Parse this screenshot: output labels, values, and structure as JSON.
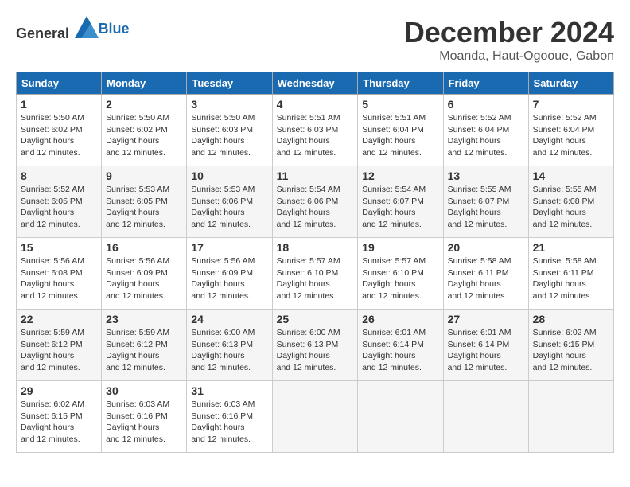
{
  "header": {
    "logo_general": "General",
    "logo_blue": "Blue",
    "month_title": "December 2024",
    "location": "Moanda, Haut-Ogooue, Gabon"
  },
  "days_of_week": [
    "Sunday",
    "Monday",
    "Tuesday",
    "Wednesday",
    "Thursday",
    "Friday",
    "Saturday"
  ],
  "weeks": [
    [
      {
        "day": "1",
        "sunrise": "5:50 AM",
        "sunset": "6:02 PM",
        "daylight": "12 hours and 12 minutes."
      },
      {
        "day": "2",
        "sunrise": "5:50 AM",
        "sunset": "6:02 PM",
        "daylight": "12 hours and 12 minutes."
      },
      {
        "day": "3",
        "sunrise": "5:50 AM",
        "sunset": "6:03 PM",
        "daylight": "12 hours and 12 minutes."
      },
      {
        "day": "4",
        "sunrise": "5:51 AM",
        "sunset": "6:03 PM",
        "daylight": "12 hours and 12 minutes."
      },
      {
        "day": "5",
        "sunrise": "5:51 AM",
        "sunset": "6:04 PM",
        "daylight": "12 hours and 12 minutes."
      },
      {
        "day": "6",
        "sunrise": "5:52 AM",
        "sunset": "6:04 PM",
        "daylight": "12 hours and 12 minutes."
      },
      {
        "day": "7",
        "sunrise": "5:52 AM",
        "sunset": "6:04 PM",
        "daylight": "12 hours and 12 minutes."
      }
    ],
    [
      {
        "day": "8",
        "sunrise": "5:52 AM",
        "sunset": "6:05 PM",
        "daylight": "12 hours and 12 minutes."
      },
      {
        "day": "9",
        "sunrise": "5:53 AM",
        "sunset": "6:05 PM",
        "daylight": "12 hours and 12 minutes."
      },
      {
        "day": "10",
        "sunrise": "5:53 AM",
        "sunset": "6:06 PM",
        "daylight": "12 hours and 12 minutes."
      },
      {
        "day": "11",
        "sunrise": "5:54 AM",
        "sunset": "6:06 PM",
        "daylight": "12 hours and 12 minutes."
      },
      {
        "day": "12",
        "sunrise": "5:54 AM",
        "sunset": "6:07 PM",
        "daylight": "12 hours and 12 minutes."
      },
      {
        "day": "13",
        "sunrise": "5:55 AM",
        "sunset": "6:07 PM",
        "daylight": "12 hours and 12 minutes."
      },
      {
        "day": "14",
        "sunrise": "5:55 AM",
        "sunset": "6:08 PM",
        "daylight": "12 hours and 12 minutes."
      }
    ],
    [
      {
        "day": "15",
        "sunrise": "5:56 AM",
        "sunset": "6:08 PM",
        "daylight": "12 hours and 12 minutes."
      },
      {
        "day": "16",
        "sunrise": "5:56 AM",
        "sunset": "6:09 PM",
        "daylight": "12 hours and 12 minutes."
      },
      {
        "day": "17",
        "sunrise": "5:56 AM",
        "sunset": "6:09 PM",
        "daylight": "12 hours and 12 minutes."
      },
      {
        "day": "18",
        "sunrise": "5:57 AM",
        "sunset": "6:10 PM",
        "daylight": "12 hours and 12 minutes."
      },
      {
        "day": "19",
        "sunrise": "5:57 AM",
        "sunset": "6:10 PM",
        "daylight": "12 hours and 12 minutes."
      },
      {
        "day": "20",
        "sunrise": "5:58 AM",
        "sunset": "6:11 PM",
        "daylight": "12 hours and 12 minutes."
      },
      {
        "day": "21",
        "sunrise": "5:58 AM",
        "sunset": "6:11 PM",
        "daylight": "12 hours and 12 minutes."
      }
    ],
    [
      {
        "day": "22",
        "sunrise": "5:59 AM",
        "sunset": "6:12 PM",
        "daylight": "12 hours and 12 minutes."
      },
      {
        "day": "23",
        "sunrise": "5:59 AM",
        "sunset": "6:12 PM",
        "daylight": "12 hours and 12 minutes."
      },
      {
        "day": "24",
        "sunrise": "6:00 AM",
        "sunset": "6:13 PM",
        "daylight": "12 hours and 12 minutes."
      },
      {
        "day": "25",
        "sunrise": "6:00 AM",
        "sunset": "6:13 PM",
        "daylight": "12 hours and 12 minutes."
      },
      {
        "day": "26",
        "sunrise": "6:01 AM",
        "sunset": "6:14 PM",
        "daylight": "12 hours and 12 minutes."
      },
      {
        "day": "27",
        "sunrise": "6:01 AM",
        "sunset": "6:14 PM",
        "daylight": "12 hours and 12 minutes."
      },
      {
        "day": "28",
        "sunrise": "6:02 AM",
        "sunset": "6:15 PM",
        "daylight": "12 hours and 12 minutes."
      }
    ],
    [
      {
        "day": "29",
        "sunrise": "6:02 AM",
        "sunset": "6:15 PM",
        "daylight": "12 hours and 12 minutes."
      },
      {
        "day": "30",
        "sunrise": "6:03 AM",
        "sunset": "6:16 PM",
        "daylight": "12 hours and 12 minutes."
      },
      {
        "day": "31",
        "sunrise": "6:03 AM",
        "sunset": "6:16 PM",
        "daylight": "12 hours and 12 minutes."
      },
      null,
      null,
      null,
      null
    ]
  ]
}
